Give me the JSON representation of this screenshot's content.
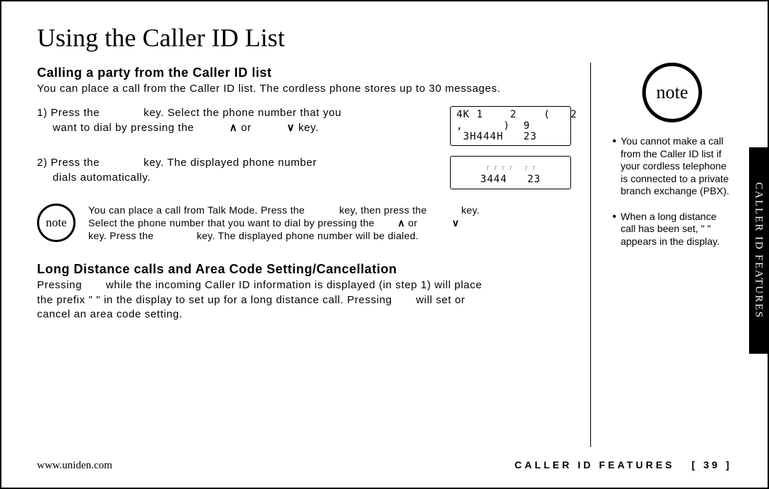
{
  "title": "Using the Caller ID List",
  "section1": {
    "heading": "Calling a party from the Caller ID list",
    "intro": "You can place a call from the Caller ID list. The cordless phone stores up to 30 messages."
  },
  "step1": {
    "pre": "1) Press the",
    "mid": "key. Select the phone number that you",
    "line2a": "want to dial by pressing the",
    "or": "or",
    "end": "key."
  },
  "step2": {
    "pre": "2) Press the",
    "mid": "key. The displayed phone number",
    "line2": "dials automatically."
  },
  "lcd1": {
    "line1": "4K 1    2    (   2",
    "line2": ",      )  9",
    "line3": " 3H444H   23"
  },
  "lcd2": {
    "dashes": "┌ ┌ ┌ ┌   ┌ ┌",
    "line": "3444   23"
  },
  "inline_note": {
    "label": "note",
    "l1a": "You can place a call from Talk Mode. Press the",
    "l1b": "key, then press the",
    "l1c": "key.",
    "l2a": "Select the phone number that you want to dial by pressing the",
    "l2or": "or",
    "l3a": "key. Press the",
    "l3b": "key. The displayed phone number will be dialed."
  },
  "section2": {
    "heading": "Long Distance calls and Area Code Setting/Cancellation",
    "p1a": "Pressing",
    "p1b": "while the incoming Caller ID information is displayed (in step 1) will place",
    "p2a": "the prefix \" \" in the display to set up for a long distance call. Pressing",
    "p2b": "will set or",
    "p3": "cancel an area code setting."
  },
  "right": {
    "note_label": "note",
    "b1": "You cannot make a call from the Caller ID list if your cordless telephone is connected to a private branch exchange (PBX).",
    "b2": "When a long distance call has been set, \" \" appears in the display."
  },
  "side_tab": "CALLER ID FEATURES",
  "footer": {
    "url": "www.uniden.com",
    "section": "CALLER ID FEATURES",
    "page": "[ 39 ]"
  }
}
